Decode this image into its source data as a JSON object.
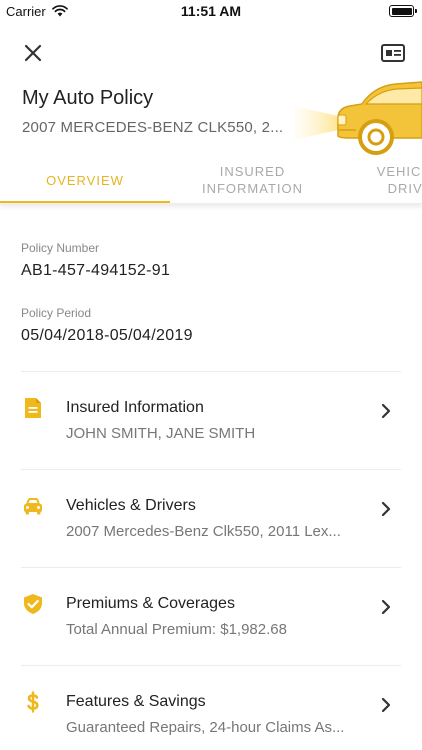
{
  "status_bar": {
    "carrier": "Carrier",
    "time": "11:51 AM"
  },
  "header": {
    "title": "My Auto Policy",
    "subtitle": "2007 MERCEDES-BENZ CLK550, 2...",
    "accent_color": "#EFB81D"
  },
  "tabs": [
    {
      "label": "OVERVIEW",
      "active": true
    },
    {
      "label": "INSURED INFORMATION",
      "active": false
    },
    {
      "label": "VEHICLES & DRIVERS",
      "active": false
    }
  ],
  "overview": {
    "policy_number_label": "Policy Number",
    "policy_number": "AB1-457-494152-91",
    "policy_period_label": "Policy Period",
    "policy_period": "05/04/2018-05/04/2019"
  },
  "sections": [
    {
      "title": "Insured Information",
      "subtitle": "JOHN SMITH, JANE SMITH",
      "icon": "document-icon"
    },
    {
      "title": "Vehicles & Drivers",
      "subtitle": "2007 Mercedes-Benz Clk550, 2011 Lex...",
      "icon": "car-icon"
    },
    {
      "title": "Premiums & Coverages",
      "subtitle": "Total Annual Premium: $1,982.68",
      "icon": "shield-check-icon"
    },
    {
      "title": "Features & Savings",
      "subtitle": "Guaranteed Repairs, 24-hour Claims As...",
      "icon": "dollar-icon"
    }
  ]
}
